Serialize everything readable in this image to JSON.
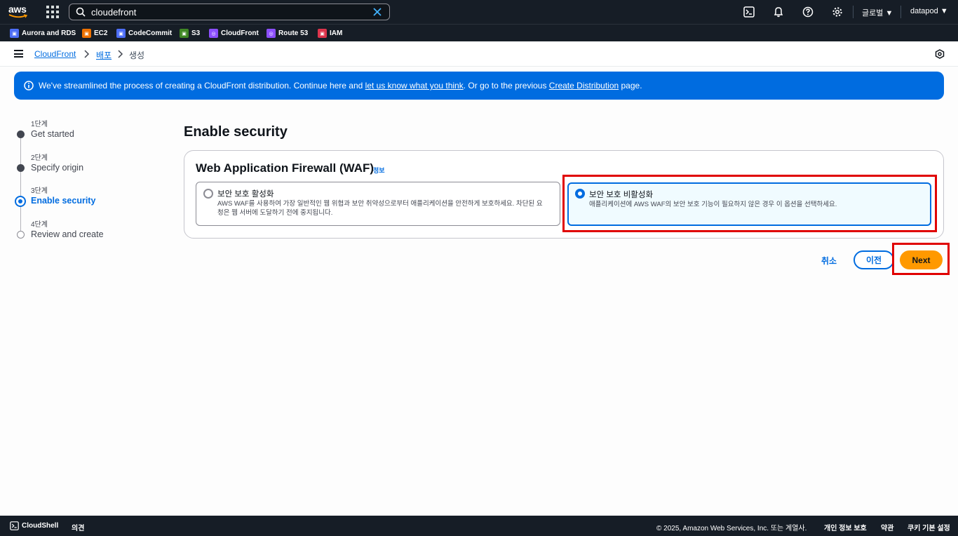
{
  "topnav": {
    "logo_text": "aws",
    "search_value": "cloudefront",
    "region": "글로벌",
    "account": "datapod"
  },
  "favorites": [
    {
      "label": "Aurora and RDS",
      "icon": "rds-icon",
      "color": "#4d6ef7"
    },
    {
      "label": "EC2",
      "icon": "ec2-icon",
      "color": "#ed7100"
    },
    {
      "label": "CodeCommit",
      "icon": "codecommit-icon",
      "color": "#4d6ef7"
    },
    {
      "label": "S3",
      "icon": "s3-icon",
      "color": "#3f8624"
    },
    {
      "label": "CloudFront",
      "icon": "cloudfront-icon",
      "color": "#8c4fff"
    },
    {
      "label": "Route 53",
      "icon": "route53-icon",
      "color": "#8c4fff"
    },
    {
      "label": "IAM",
      "icon": "iam-icon",
      "color": "#dd344c"
    }
  ],
  "breadcrumb": {
    "items": [
      "CloudFront",
      "배포",
      "생성"
    ]
  },
  "banner": {
    "text_1": "We've streamlined the process of creating a CloudFront distribution. Continue here and ",
    "link_1": "let us know what you think",
    "text_2": ". Or go to the previous ",
    "link_2": "Create Distribution",
    "text_3": " page."
  },
  "steps": [
    {
      "num": "1단계",
      "name": "Get started",
      "state": "done"
    },
    {
      "num": "2단계",
      "name": "Specify origin",
      "state": "done"
    },
    {
      "num": "3단계",
      "name": "Enable security",
      "state": "active"
    },
    {
      "num": "4단계",
      "name": "Review and create",
      "state": "todo"
    }
  ],
  "main": {
    "title": "Enable security",
    "panel_title": "Web Application Firewall (WAF)",
    "info_link": "정보",
    "options": [
      {
        "title": "보안 보호 활성화",
        "desc_1": "AWS WAF를 사용하여 가장 일반적인 웹 위협과 보안 취약성으로부터 애플리케이션을 안전하게 보호하세요. 차단된 요",
        "desc_2": "청은 웹 서버에 도달하기 전에 중지됩니다.",
        "selected": false
      },
      {
        "title": "보안 보호 비활성화",
        "desc_1": "애플리케이션에 AWS WAF의 보안 보호 기능이 필요하지 않은 경우 이 옵션을 선택하세요.",
        "desc_2": "",
        "selected": true
      }
    ],
    "cancel_label": "취소",
    "prev_label": "이전",
    "next_label": "Next"
  },
  "footer": {
    "cloudshell": "CloudShell",
    "feedback": "의견",
    "copyright": "© 2025, Amazon Web Services, Inc. 또는 계열사.",
    "privacy": "개인 정보 보호",
    "terms": "약관",
    "cookies": "쿠키 기본 설정"
  }
}
